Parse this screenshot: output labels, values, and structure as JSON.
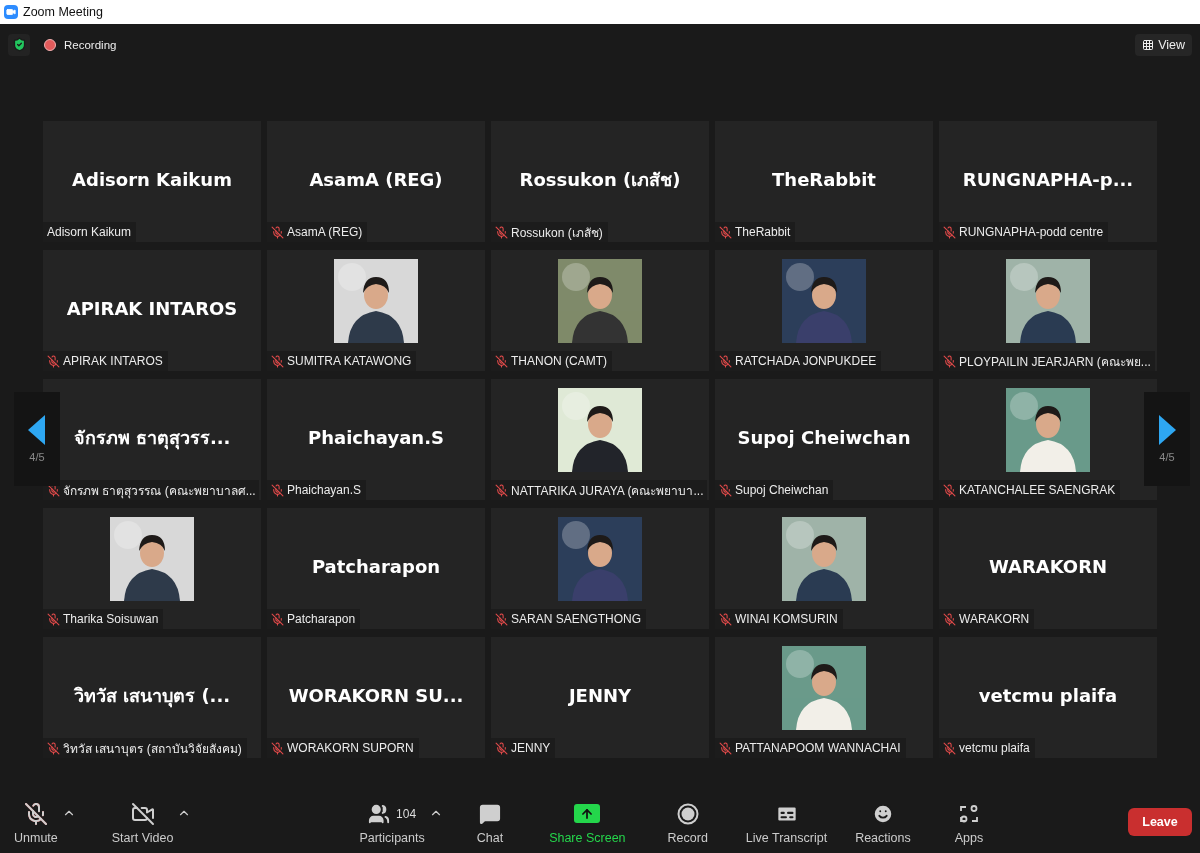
{
  "window": {
    "title": "Zoom Meeting"
  },
  "top_bar": {
    "recording": "Recording",
    "view": "View"
  },
  "pager": {
    "left": "4/5",
    "right": "4/5"
  },
  "tiles": [
    {
      "kind": "name",
      "display": "Adisorn Kaikum",
      "name": "Adisorn Kaikum",
      "muted": false
    },
    {
      "kind": "name",
      "display": "AsamA (REG)",
      "name": "AsamA (REG)",
      "muted": true
    },
    {
      "kind": "name",
      "display": "Rossukon (เภสัช)",
      "name": "Rossukon (เภสัช)",
      "muted": true
    },
    {
      "kind": "name",
      "display": "TheRabbit",
      "name": "TheRabbit",
      "muted": true
    },
    {
      "kind": "name",
      "display": "RUNGNAPHA-p...",
      "name": "RUNGNAPHA-podd centre",
      "muted": true
    },
    {
      "kind": "name",
      "display": "APIRAK INTAROS",
      "name": "APIRAK INTAROS",
      "muted": true
    },
    {
      "kind": "picture",
      "name": "SUMITRA KATAWONG",
      "muted": true
    },
    {
      "kind": "picture",
      "name": "THANON (CAMT)",
      "muted": true
    },
    {
      "kind": "picture",
      "name": "RATCHADA JONPUKDEE",
      "muted": true
    },
    {
      "kind": "picture",
      "name": "PLOYPAILIN JEARJARN (คณะพย...",
      "muted": true
    },
    {
      "kind": "name",
      "display": "จักรภพ ธาตุสุวรร...",
      "name": "จักรภพ ธาตุสุวรรณ  (คณะพยาบาลศ...",
      "muted": true
    },
    {
      "kind": "name",
      "display": "Phaichayan.S",
      "name": "Phaichayan.S",
      "muted": true
    },
    {
      "kind": "picture",
      "name": "NATTARIKA JURAYA (คณะพยาบา...",
      "muted": true
    },
    {
      "kind": "name",
      "display": "Supoj Cheiwchan",
      "name": "Supoj Cheiwchan",
      "muted": true
    },
    {
      "kind": "picture",
      "name": "KATANCHALEE SAENGRAK",
      "muted": true
    },
    {
      "kind": "picture",
      "name": "Tharika Soisuwan",
      "muted": true
    },
    {
      "kind": "name",
      "display": "Patcharapon",
      "name": "Patcharapon",
      "muted": true
    },
    {
      "kind": "picture",
      "name": "SARAN SAENGTHONG",
      "muted": true
    },
    {
      "kind": "picture",
      "name": "WINAI KOMSURIN",
      "muted": true
    },
    {
      "kind": "name",
      "display": "WARAKORN",
      "name": "WARAKORN",
      "muted": true
    },
    {
      "kind": "name",
      "display": "วิทวัส เสนาบุตร (...",
      "name": "วิทวัส เสนาบุตร (สถาบันวิจัยสังคม)",
      "muted": true
    },
    {
      "kind": "name",
      "display": "WORAKORN  SU...",
      "name": "WORAKORN SUPORN",
      "muted": true
    },
    {
      "kind": "name",
      "display": "JENNY",
      "name": "JENNY",
      "muted": true
    },
    {
      "kind": "picture",
      "name": "PATTANAPOOM WANNACHAI",
      "muted": true
    },
    {
      "kind": "name",
      "display": "vetcmu plaifa",
      "name": "vetcmu plaifa",
      "muted": true
    }
  ],
  "toolbar": [
    {
      "kind": "mic",
      "label": "Unmute",
      "caret": true
    },
    {
      "kind": "video",
      "label": "Start Video",
      "caret": true
    },
    {
      "kind": "participants",
      "label": "Participants",
      "count": "104",
      "caret": true
    },
    {
      "kind": "chat",
      "label": "Chat",
      "caret": false
    },
    {
      "kind": "share",
      "label": "Share Screen",
      "caret": false
    },
    {
      "kind": "record",
      "label": "Record",
      "caret": false
    },
    {
      "kind": "transcript",
      "label": "Live Transcript",
      "caret": false
    },
    {
      "kind": "reactions",
      "label": "Reactions",
      "caret": false
    },
    {
      "kind": "apps",
      "label": "Apps",
      "caret": false
    }
  ],
  "leave": "Leave"
}
